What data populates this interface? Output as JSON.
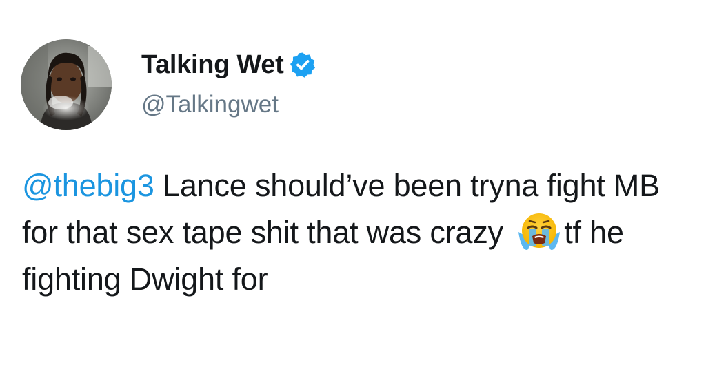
{
  "tweet": {
    "author": {
      "display_name": "Talking Wet",
      "handle": "@Talkingwet",
      "verified": true,
      "avatar_icon": "user-avatar-photo",
      "verified_icon": "verified-badge-icon",
      "verified_color": "#1da1f2"
    },
    "body": {
      "mention": "@thebig3",
      "text_part1": "Lance should’ve been tryna fight MB for that sex tape shit that was crazy",
      "emoji_icon": "loudly-crying-face-icon",
      "text_part2": "tf he fighting Dwight for"
    },
    "colors": {
      "text": "#14171a",
      "handle": "#657786",
      "mention": "#1b95e0",
      "background": "#ffffff"
    }
  }
}
